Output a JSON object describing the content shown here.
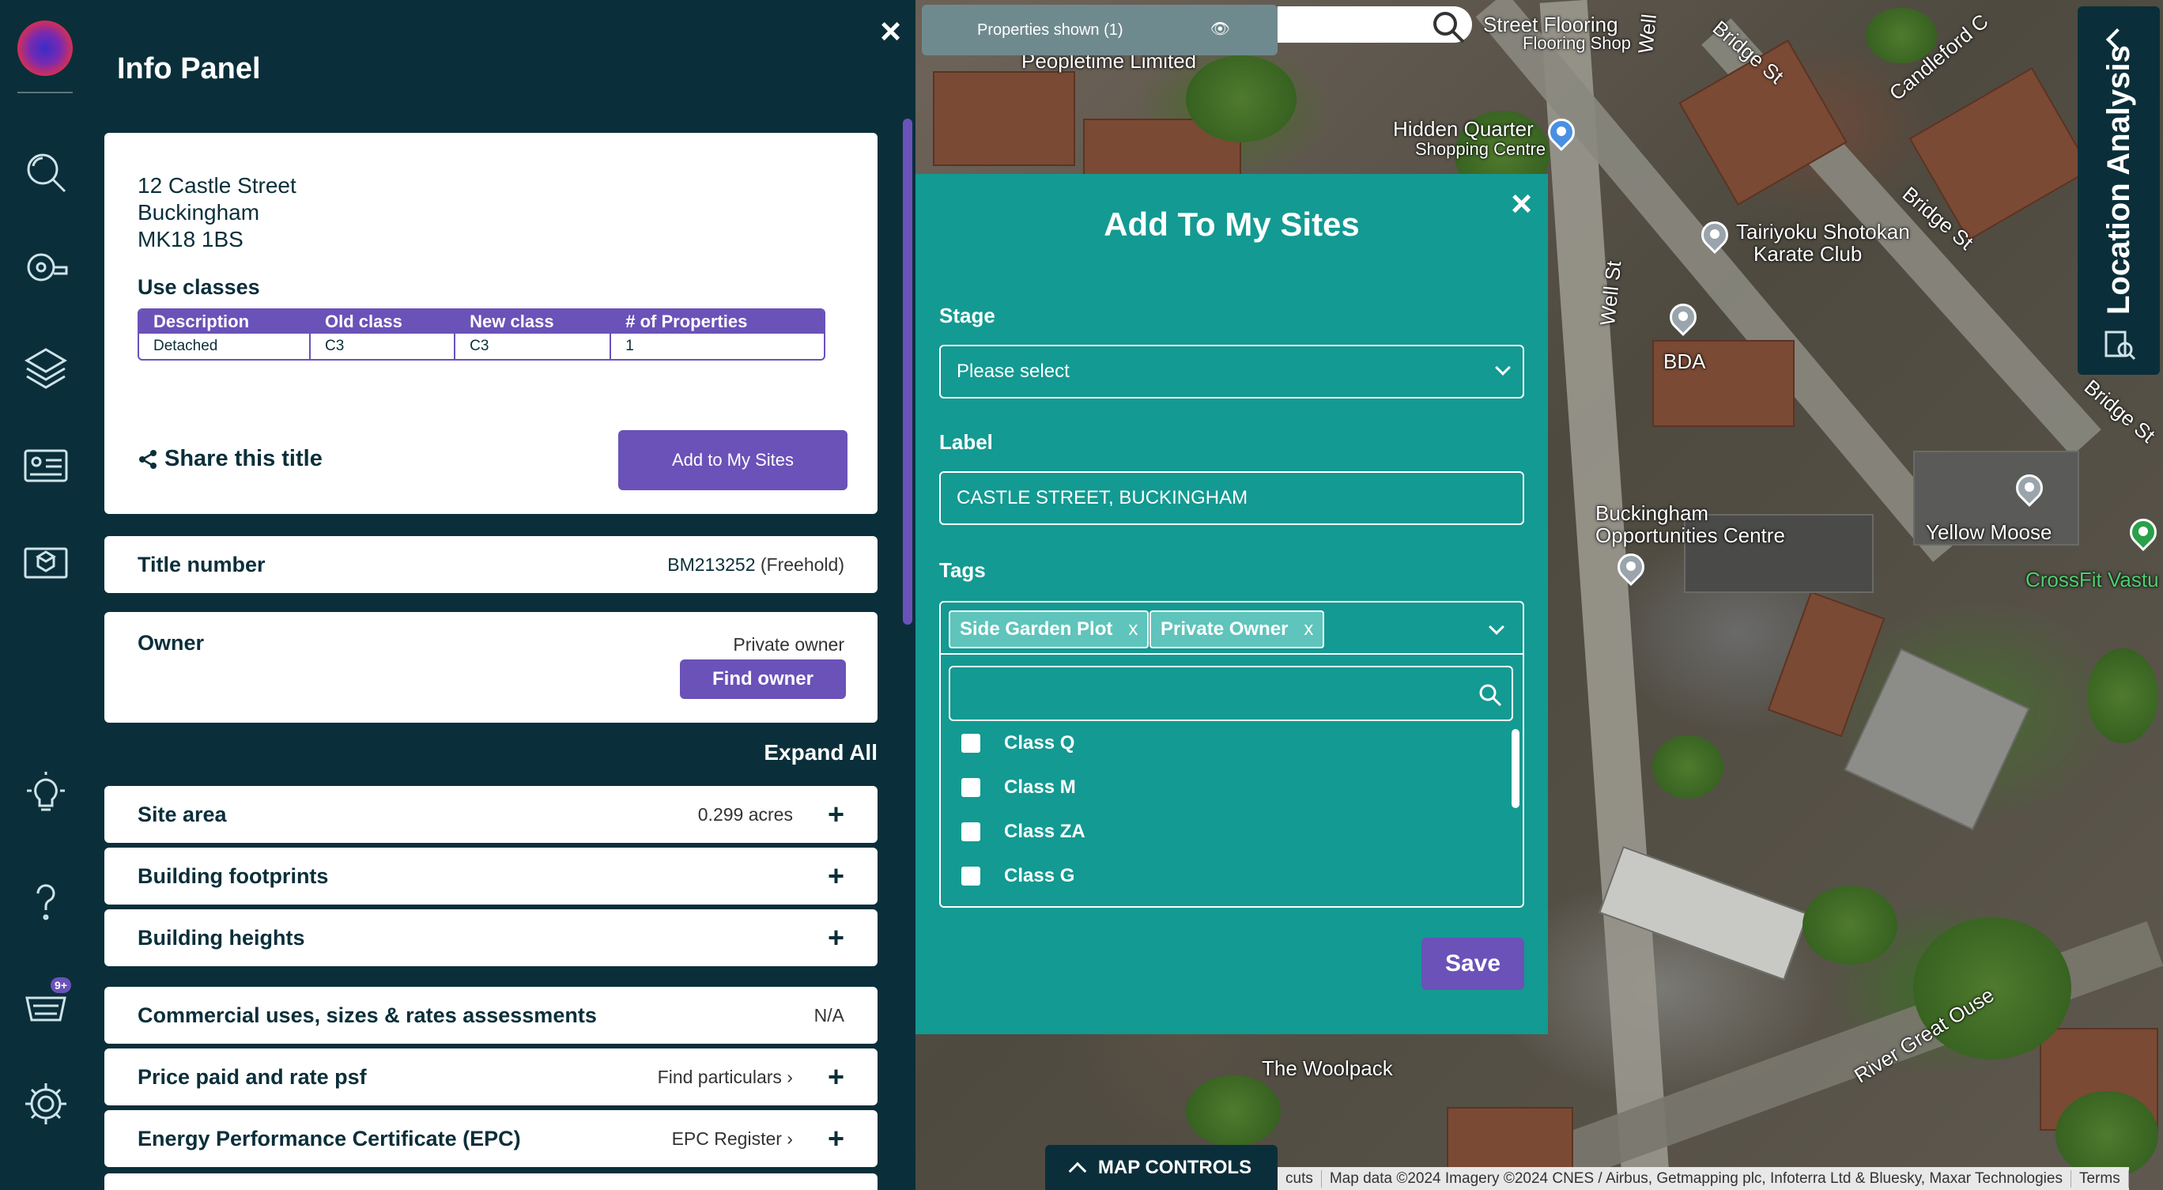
{
  "map": {
    "labels": [
      "Peopletime Limited",
      "Street Flooring",
      "Flooring Shop",
      "Hidden Quarter",
      "Shopping Centre",
      "Tairiyoku Shotokan",
      "Karate Club",
      "BDA",
      "Buckingham",
      "Opportunities Centre",
      "Yellow Moose",
      "CrossFit Vastu",
      "The Woolpack",
      "River Great Ouse",
      "Bridge St",
      "Bridge St",
      "Candleford C",
      "Well St",
      "Well",
      "Bridge St"
    ]
  },
  "nav": {
    "basket_badge": "9+",
    "icons": [
      "search-icon",
      "tape-measure-icon",
      "layers-icon",
      "id-card-icon",
      "map-book-icon",
      "lightbulb-icon",
      "help-icon",
      "basket-icon",
      "settings-icon"
    ]
  },
  "info_panel": {
    "title": "Info Panel",
    "close": "×",
    "address": [
      "12 Castle Street",
      "Buckingham",
      "MK18 1BS"
    ],
    "use_classes_title": "Use classes",
    "use_classes_headers": [
      "Description",
      "Old class",
      "New class",
      "# of Properties"
    ],
    "use_classes_rows": [
      [
        "Detached",
        "C3",
        "C3",
        "1"
      ]
    ],
    "share_label": "Share this title",
    "add_to_sites_label": "Add to My Sites",
    "title_number_label": "Title number",
    "title_number_value": "BM213252",
    "title_tenure": "(Freehold)",
    "owner_label": "Owner",
    "owner_value": "Private owner",
    "find_owner_label": "Find owner",
    "expand_all_label": "Expand All",
    "rows": [
      {
        "label": "Site area",
        "value": "0.299 acres"
      },
      {
        "label": "Building footprints",
        "value": ""
      },
      {
        "label": "Building heights",
        "value": ""
      },
      {
        "label": "Commercial uses, sizes & rates assessments",
        "value": "N/A"
      },
      {
        "label": "Price paid and rate psf",
        "link": "Find particulars"
      },
      {
        "label": "Energy Performance Certificate (EPC)",
        "link": "EPC Register"
      }
    ]
  },
  "modal": {
    "title": "Add To My Sites",
    "close": "×",
    "stage_label": "Stage",
    "stage_value": "Please select",
    "label_label": "Label",
    "label_value": "CASTLE STREET, BUCKINGHAM",
    "tags_label": "Tags",
    "tags": [
      "Side Garden Plot",
      "Private Owner"
    ],
    "tag_remove": "x",
    "options": [
      "Class Q",
      "Class M",
      "Class ZA",
      "Class G"
    ],
    "save_label": "Save"
  },
  "top_bar": {
    "properties_shown": "Properties shown (1)"
  },
  "location_tab": {
    "label": "Location Analysis"
  },
  "map_controls": {
    "label": "MAP CONTROLS"
  },
  "attribution": [
    "cuts",
    "Map data ©2024 Imagery ©2024 CNES / Airbus, Getmapping plc, Infoterra Ltd & Bluesky, Maxar Technologies",
    "Terms"
  ],
  "colors": {
    "panel": "#0a2f3a",
    "accent": "#6a52b8",
    "modal": "#139a92"
  }
}
